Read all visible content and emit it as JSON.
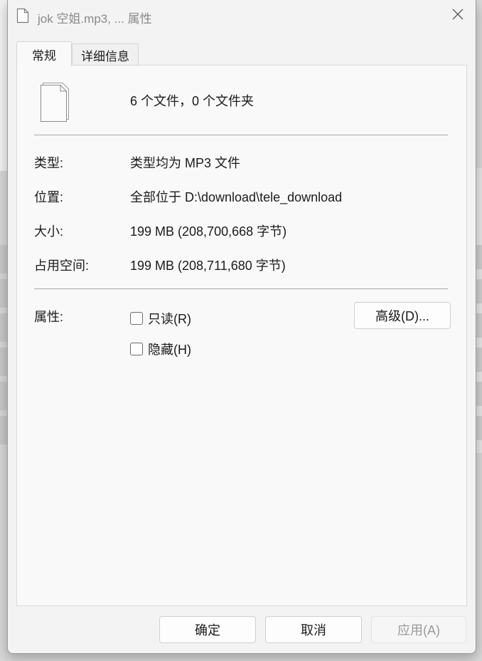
{
  "window": {
    "title": "jok 空姐.mp3, ... 属性",
    "close_icon": "close-icon"
  },
  "tabs": [
    {
      "label": "常规",
      "active": true
    },
    {
      "label": "详细信息",
      "active": false
    }
  ],
  "general": {
    "summary": "6 个文件，0 个文件夹",
    "type_label": "类型:",
    "type_value": "类型均为 MP3 文件",
    "location_label": "位置:",
    "location_value": "全部位于 D:\\download\\tele_download",
    "size_label": "大小:",
    "size_value": "199 MB (208,700,668 字节)",
    "size_on_disk_label": "占用空间:",
    "size_on_disk_value": "199 MB (208,711,680 字节)",
    "attributes_label": "属性:",
    "readonly_label": "只读(R)",
    "readonly_checked": false,
    "hidden_label": "隐藏(H)",
    "hidden_checked": false,
    "advanced_button": "高级(D)..."
  },
  "footer": {
    "ok_label": "确定",
    "cancel_label": "取消",
    "apply_label": "应用(A)",
    "apply_enabled": false
  }
}
